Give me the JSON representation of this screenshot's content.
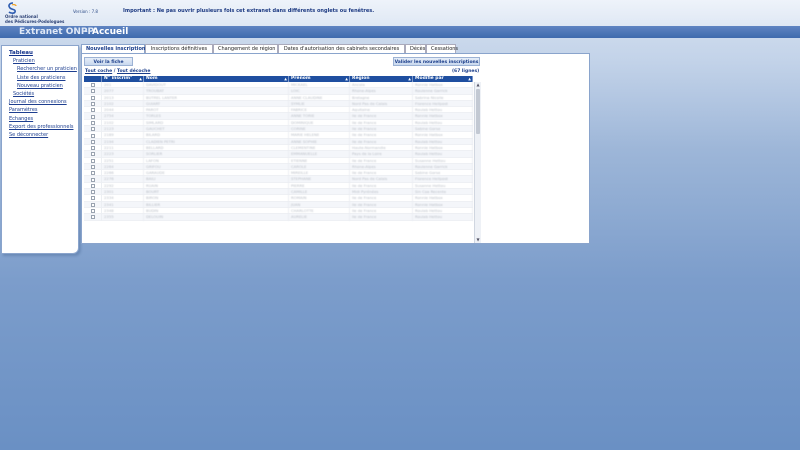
{
  "header": {
    "logo_line1": "Ordre national",
    "logo_line2": "des Pédicures-Podologues",
    "version": "Version : 7.8",
    "important": "Important : Ne pas ouvrir plusieurs fois cet extranet dans différents onglets ou fenêtres.",
    "app_title": "Extranet ONPP",
    "separator": "-",
    "page_title": "Accueil"
  },
  "sidebar": {
    "items": [
      {
        "label": "Tableau"
      },
      {
        "label": "Praticien"
      },
      {
        "label": "Rechercher un praticien"
      },
      {
        "label": "Liste des praticiens"
      },
      {
        "label": "Nouveau praticien"
      },
      {
        "label": "Sociétés"
      },
      {
        "label": "Journal des connexions"
      },
      {
        "label": "Paramètres"
      },
      {
        "label": "Echanges"
      },
      {
        "label": "Export des professionnels"
      },
      {
        "label": "Se déconnecter"
      }
    ]
  },
  "tabs": [
    {
      "label": "Nouvelles inscriptions"
    },
    {
      "label": "Inscriptions définitives"
    },
    {
      "label": "Changement de région"
    },
    {
      "label": "Dates d'autorisation des cabinets secondaires"
    },
    {
      "label": "Décès"
    },
    {
      "label": "Cessations"
    }
  ],
  "toolbar": {
    "view_button": "Voir la fiche",
    "validate_button": "Valider les nouvelles inscriptions",
    "check_all": "Tout coche",
    "link_sep": "/",
    "uncheck_all": "Tout décoche",
    "count": "(67 lignes)"
  },
  "table": {
    "headers": [
      "N° inscrim°",
      "Nom",
      "Prénom",
      "Région",
      "Modifié par"
    ],
    "rows": [
      [
        "201",
        "DAVIDOUT",
        "MICKAEL",
        "Ancola",
        "Ronnie Hatbox"
      ],
      [
        "2077",
        "TROUBAT",
        "LOIC",
        "Rhone-Alpes",
        "Roulenne Garrick"
      ],
      [
        "2013",
        "BUTREL LANTER",
        "ANNE CLAUDINE",
        "Bretagne",
        "Sabrina Nicolle"
      ],
      [
        "2102",
        "GUIART",
        "SYMLIE",
        "Nord Pas de Calais",
        "Florence Hellpost"
      ],
      [
        "2044",
        "PAROT",
        "FABRICE",
        "Aquitaine",
        "Roulab Hettou"
      ],
      [
        "2754",
        "TORLES",
        "ANNE TORIE",
        "Ile de France",
        "Ronnie Hatbox"
      ],
      [
        "2102",
        "SIMLARD",
        "DOMINIQUE",
        "Ile de France",
        "Roulab Hettou"
      ],
      [
        "2123",
        "GAUCHET",
        "CORINE",
        "Ile de France",
        "Sabine Gorse"
      ],
      [
        "2189",
        "BILARD",
        "MARIE HELENE",
        "Ile de France",
        "Ronnie Hatbox"
      ],
      [
        "2194",
        "CLADIEN PETRI",
        "ANNE SOPHIE",
        "Ile de France",
        "Roulab Hettou"
      ],
      [
        "2211",
        "BELLARD",
        "CLEMENTINE",
        "Haute-Normandie",
        "Ronnie Hatbox"
      ],
      [
        "2223",
        "SORLIER",
        "EMMANUELLE",
        "Pays de la Loire",
        "Roulab Hettou"
      ],
      [
        "2251",
        "LAFON",
        "ETIENNE",
        "Ile de France",
        "Susanne Hettou"
      ],
      [
        "2264",
        "GRIFOU",
        "CAROLE",
        "Rhone-Alpes",
        "Roulenne Garrick"
      ],
      [
        "2266",
        "GARAUDE",
        "MIREILLE",
        "Ile de France",
        "Sabine Gorse"
      ],
      [
        "2276",
        "BAILI",
        "STEPHANE",
        "Nord Pas de Calais",
        "Florence Hellpost"
      ],
      [
        "2292",
        "RUAIN",
        "PIERRE",
        "Ile de France",
        "Susanne Hettou"
      ],
      [
        "2301",
        "BOURT",
        "CAMILLE",
        "Midi Pyrénées",
        "Sin Coa Recente"
      ],
      [
        "2334",
        "BIRON",
        "ROMAIN",
        "Ile de France",
        "Ronnie Hatbox"
      ],
      [
        "2341",
        "BILLIER",
        "JUAN",
        "Ile de France",
        "Ronnie Hatbox"
      ],
      [
        "2348",
        "BUDIN",
        "CHARLOTTE",
        "Ile de France",
        "Roulab Hettou"
      ],
      [
        "2355",
        "DELOUIN",
        "AURELIE",
        "Ile de France",
        "Roulab Hettou"
      ]
    ]
  },
  "icons": {
    "sort": "sort-arrow-icon",
    "scroll_up": "scroll-up-icon",
    "scroll_down": "scroll-down-icon"
  },
  "colors": {
    "header_bar": "#3e6aad",
    "grid_header": "#1f4fa0",
    "link": "#1d3e8f"
  }
}
